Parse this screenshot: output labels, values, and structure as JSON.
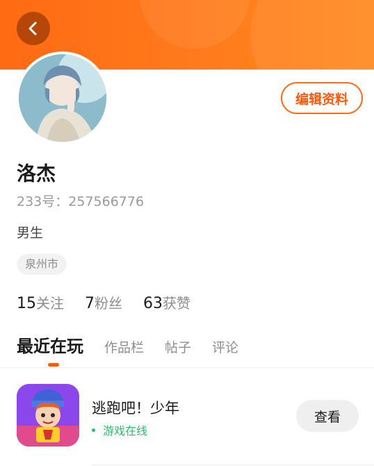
{
  "header": {
    "back_icon": "chevron-left-icon",
    "accent": "#ff6a12"
  },
  "profile": {
    "name": "洛杰",
    "uid": "233号：257566776",
    "gender": "男生",
    "city": "泉州市",
    "edit_label": "编辑资料"
  },
  "stats": [
    {
      "num": "15",
      "label": "关注"
    },
    {
      "num": "7",
      "label": "粉丝"
    },
    {
      "num": "63",
      "label": "获赞"
    }
  ],
  "tabs": [
    {
      "label": "最近在玩",
      "active": true
    },
    {
      "label": "作品栏",
      "active": false
    },
    {
      "label": "帖子",
      "active": false
    },
    {
      "label": "评论",
      "active": false
    }
  ],
  "recent_game": {
    "title": "逃跑吧！少年",
    "status": "游戏在线",
    "status_color": "#2cbf6a",
    "action": "查看"
  }
}
